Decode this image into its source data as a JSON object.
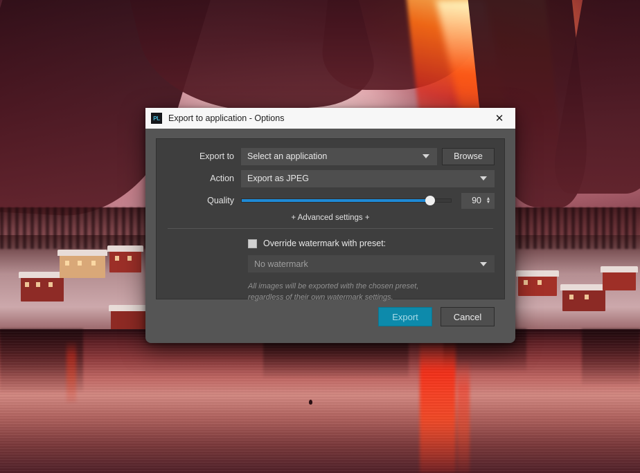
{
  "window": {
    "icon_label": "PL",
    "icon_name": "photolab-app-icon",
    "title": "Export to application - Options",
    "close_glyph": "✕"
  },
  "form": {
    "export_to": {
      "label": "Export to",
      "value": "Select an application",
      "browse_label": "Browse"
    },
    "action": {
      "label": "Action",
      "value": "Export as JPEG"
    },
    "quality": {
      "label": "Quality",
      "value": "90",
      "percent": 90,
      "min": 0,
      "max": 100,
      "spin_up": "▲",
      "spin_down": "▼"
    },
    "advanced_settings": "+ Advanced settings +"
  },
  "watermark": {
    "checkbox_label": "Override watermark with preset:",
    "checked": false,
    "preset_value": "No watermark",
    "note": "All images will be exported with the chosen preset, regardless of their own watermark settings."
  },
  "footer": {
    "export_label": "Export",
    "cancel_label": "Cancel"
  },
  "colors": {
    "accent_teal": "#0d8aab",
    "slider_blue": "#1e8ad6",
    "dialog_bg": "#555555",
    "panel_bg": "#3e3e3e",
    "titlebar_bg": "#f7f7f7"
  }
}
